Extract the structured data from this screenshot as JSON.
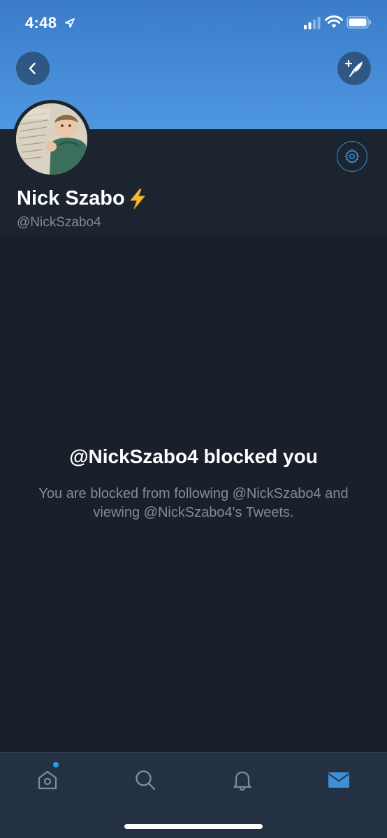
{
  "status_bar": {
    "time": "4:48",
    "icons": [
      "location-arrow-icon",
      "signal-icon",
      "wifi-icon",
      "battery-icon"
    ]
  },
  "header": {
    "back_icon": "chevron-left-icon",
    "compose_icon": "compose-tweet-icon",
    "banner_color": "#4a90d9"
  },
  "profile": {
    "name": "Nick Szabo",
    "name_badge_icon": "lightning-bolt-icon",
    "handle": "@NickSzabo4",
    "settings_icon": "gear-icon"
  },
  "blocked": {
    "title": "@NickSzabo4 blocked you",
    "description": "You are blocked from following @NickSzabo4 and viewing @NickSzabo4's Tweets."
  },
  "tab_bar": {
    "tabs": [
      {
        "icon": "home-icon",
        "active": false,
        "has_dot": true
      },
      {
        "icon": "search-icon",
        "active": false
      },
      {
        "icon": "bell-icon",
        "active": false
      },
      {
        "icon": "mail-icon",
        "active": true
      }
    ]
  },
  "colors": {
    "accent": "#1da1f2",
    "background": "#19202a",
    "secondary_text": "#7f8c99"
  }
}
